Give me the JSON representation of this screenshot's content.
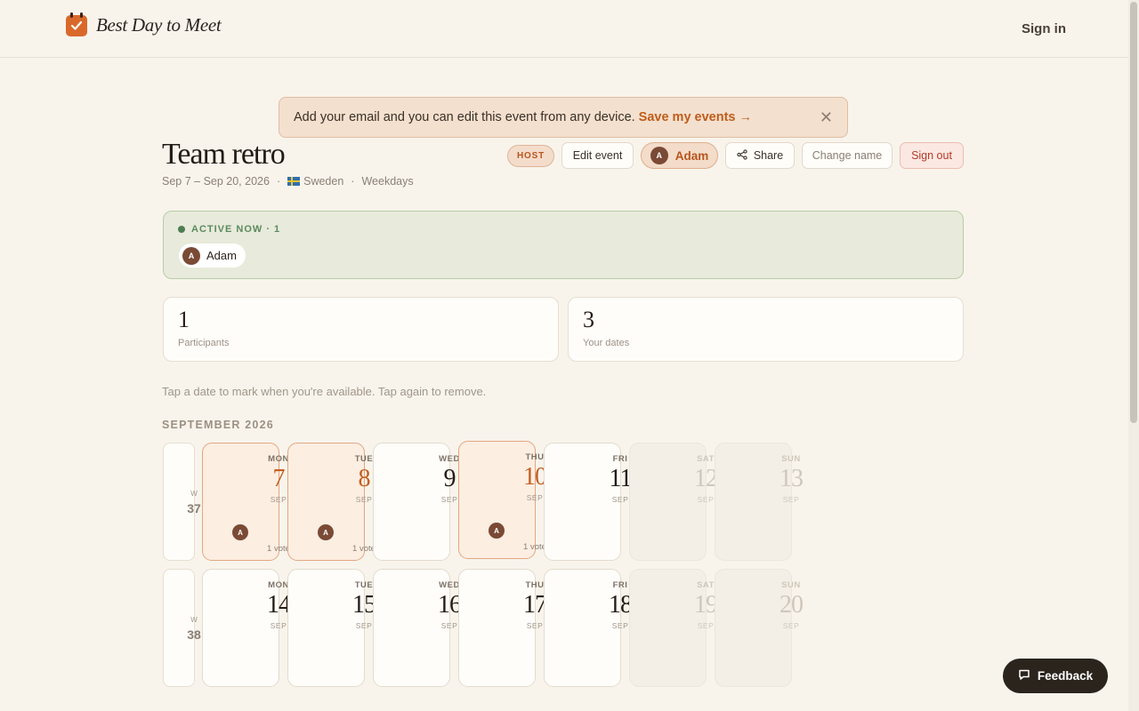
{
  "header": {
    "brand": "Best Day to Meet",
    "sign_in": "Sign in"
  },
  "banner": {
    "text": "Add your email and you can edit this event from any device.",
    "link": "Save my events →",
    "close": "✕"
  },
  "event": {
    "title": "Team retro",
    "date_range": "Sep 7 – Sep 20, 2026",
    "country": "Sweden",
    "days_filter": "Weekdays",
    "sep": "·"
  },
  "toolbar": {
    "host": "HOST",
    "edit": "Edit event",
    "user": "Adam",
    "user_initial": "A",
    "share": "Share",
    "change_name": "Change name",
    "sign_out": "Sign out"
  },
  "active_now": {
    "label": "ACTIVE NOW · 1",
    "users": [
      {
        "initial": "A",
        "name": "Adam"
      }
    ]
  },
  "stats": [
    {
      "value": "1",
      "label": "Participants"
    },
    {
      "value": "3",
      "label": "Your dates"
    }
  ],
  "hint": "Tap a date to mark when you're available. Tap again to remove.",
  "calendar": {
    "month": "SEPTEMBER 2026",
    "week_prefix": "W",
    "weeks": [
      {
        "number": "37",
        "days": [
          {
            "dow": "MON",
            "day": "7",
            "month": "SEP",
            "selected": true,
            "votes": "1 vote",
            "voter": "A"
          },
          {
            "dow": "TUE",
            "day": "8",
            "month": "SEP",
            "selected": true,
            "votes": "1 vote",
            "voter": "A"
          },
          {
            "dow": "WED",
            "day": "9",
            "month": "SEP"
          },
          {
            "dow": "THU",
            "day": "10",
            "month": "SEP",
            "selected": true,
            "votes": "1 vote",
            "voter": "A"
          },
          {
            "dow": "FRI",
            "day": "11",
            "month": "SEP"
          },
          {
            "dow": "SAT",
            "day": "12",
            "month": "SEP",
            "weekend": true
          },
          {
            "dow": "SUN",
            "day": "13",
            "month": "SEP",
            "weekend": true
          }
        ]
      },
      {
        "number": "38",
        "days": [
          {
            "dow": "MON",
            "day": "14",
            "month": "SEP"
          },
          {
            "dow": "TUE",
            "day": "15",
            "month": "SEP"
          },
          {
            "dow": "WED",
            "day": "16",
            "month": "SEP"
          },
          {
            "dow": "THU",
            "day": "17",
            "month": "SEP"
          },
          {
            "dow": "FRI",
            "day": "18",
            "month": "SEP"
          },
          {
            "dow": "SAT",
            "day": "19",
            "month": "SEP",
            "weekend": true
          },
          {
            "dow": "SUN",
            "day": "20",
            "month": "SEP",
            "weekend": true
          }
        ]
      }
    ]
  },
  "feedback": "Feedback"
}
